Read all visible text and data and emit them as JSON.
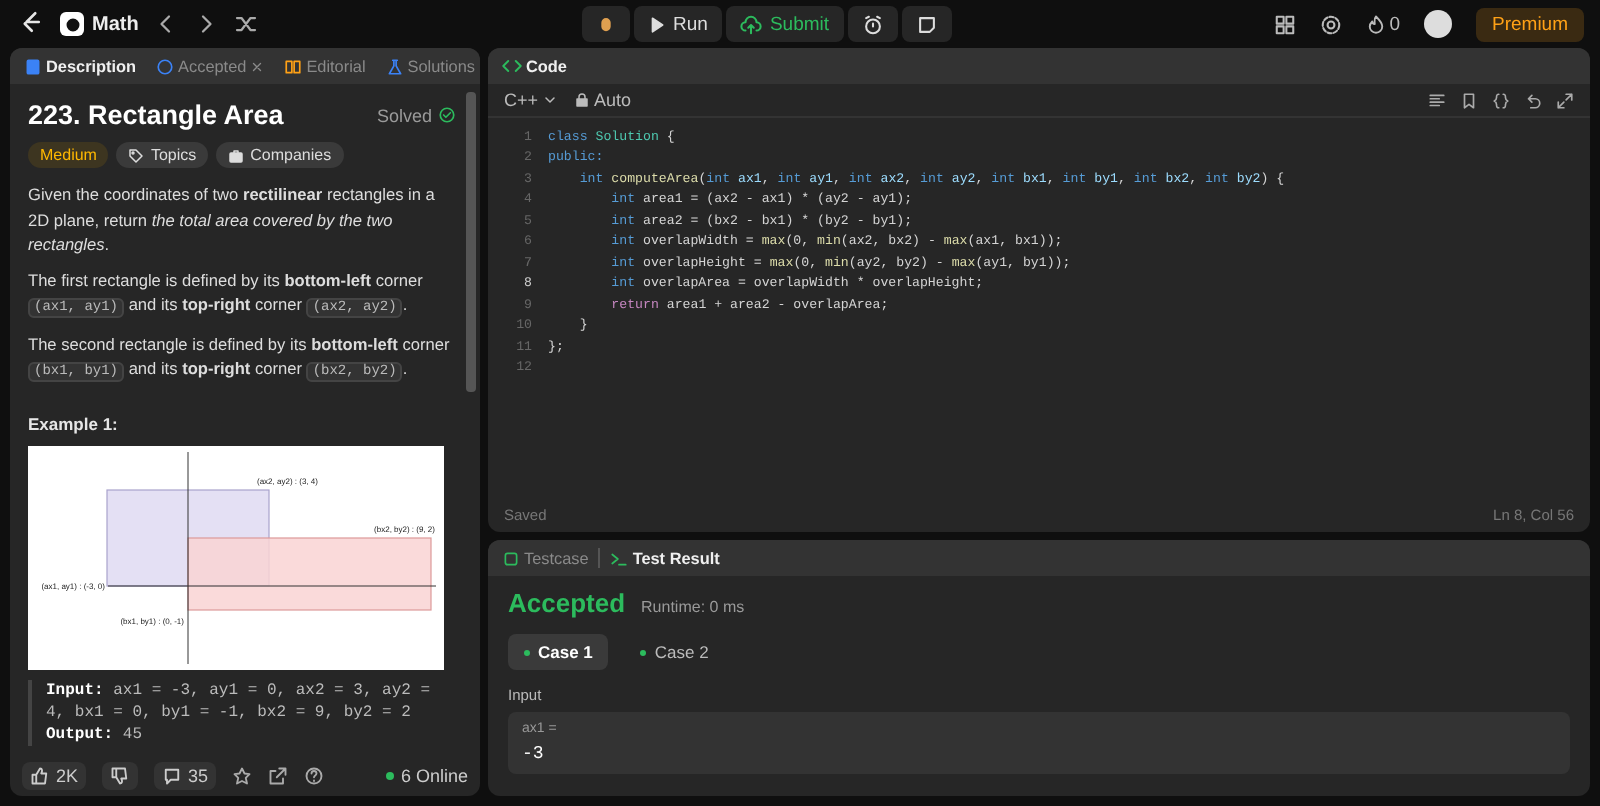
{
  "topbar": {
    "problem_list": "Math",
    "run": "Run",
    "submit": "Submit",
    "streak": "0",
    "premium": "Premium"
  },
  "description_panel": {
    "tabs": [
      {
        "label": "Description",
        "selected": true,
        "closable": false
      },
      {
        "label": "Accepted",
        "selected": false,
        "closable": true
      },
      {
        "label": "Editorial",
        "selected": false,
        "closable": false
      },
      {
        "label": "Solutions",
        "selected": false,
        "closable": false
      }
    ],
    "title": "223. Rectangle Area",
    "status": "Solved",
    "tags": [
      {
        "kind": "difficulty",
        "label": "Medium"
      },
      {
        "kind": "topics",
        "label": "Topics"
      },
      {
        "kind": "companies",
        "label": "Companies"
      }
    ],
    "paragraphs": [
      [
        {
          "kind": "text",
          "text": "Given the coordinates of two **rectilinear** rectangles in a 2D plane, return *the total area covered by the two rectangles*."
        }
      ],
      [
        {
          "kind": "text",
          "text": "The first rectangle is defined by its **bottom-left** corner "
        },
        {
          "kind": "code",
          "text": "(ax1, ay1)"
        },
        {
          "kind": "text",
          "text": " and its **top-right** corner "
        },
        {
          "kind": "code",
          "text": "(ax2, ay2)"
        },
        {
          "kind": "text",
          "text": "."
        }
      ],
      [
        {
          "kind": "text",
          "text": "The second rectangle is defined by its **bottom-left** corner "
        },
        {
          "kind": "code",
          "text": "(bx1, by1)"
        },
        {
          "kind": "text",
          "text": " and its **top-right** corner "
        },
        {
          "kind": "code",
          "text": "(bx2, by2)"
        },
        {
          "kind": "text",
          "text": "."
        }
      ]
    ],
    "example_title": "Example 1:",
    "figure_labels": [
      "(ax2, ay2) : (3, 4)",
      "(bx2, by2) : (9, 2)",
      "(ax1, ay1) : (-3, 0)",
      "(bx1, by1) : (0, -1)"
    ],
    "example_lines": [
      {
        "label": "Input:",
        "text": "ax1 = -3, ay1 = 0, ax2 = 3, ay2 = 4, bx1 = 0, by1 = -1, bx2 = 9, by2 = 2"
      },
      {
        "label": "Output:",
        "text": "45"
      }
    ],
    "likes": "2K",
    "comments": "35",
    "online": "6 Online"
  },
  "code_panel": {
    "title": "Code",
    "language": "C++",
    "mode": "Auto",
    "lines": [
      {
        "number": "1",
        "current": false,
        "tokens": [
          {
            "kind": "kw",
            "text": "class"
          },
          {
            "kind": "cls",
            "text": " Solution"
          },
          {
            "kind": "plain",
            "text": " {"
          }
        ]
      },
      {
        "number": "2",
        "current": false,
        "tokens": [
          {
            "kind": "kw",
            "text": "public:"
          }
        ]
      },
      {
        "number": "3",
        "current": false,
        "tokens": [
          {
            "kind": "kw",
            "text": "    int"
          },
          {
            "kind": "fn",
            "text": " computeArea"
          },
          {
            "kind": "plain",
            "text": "("
          },
          {
            "kind": "kw",
            "text": "int"
          },
          {
            "kind": "id",
            "text": " ax1"
          },
          {
            "kind": "plain",
            "text": ", "
          },
          {
            "kind": "kw",
            "text": "int"
          },
          {
            "kind": "id",
            "text": " ay1"
          },
          {
            "kind": "plain",
            "text": ", "
          },
          {
            "kind": "kw",
            "text": "int"
          },
          {
            "kind": "id",
            "text": " ax2"
          },
          {
            "kind": "plain",
            "text": ", "
          },
          {
            "kind": "kw",
            "text": "int"
          },
          {
            "kind": "id",
            "text": " ay2"
          },
          {
            "kind": "plain",
            "text": ", "
          },
          {
            "kind": "kw",
            "text": "int"
          },
          {
            "kind": "id",
            "text": " bx1"
          },
          {
            "kind": "plain",
            "text": ", "
          },
          {
            "kind": "kw",
            "text": "int"
          },
          {
            "kind": "id",
            "text": " by1"
          },
          {
            "kind": "plain",
            "text": ", "
          },
          {
            "kind": "kw",
            "text": "int"
          },
          {
            "kind": "id",
            "text": " bx2"
          },
          {
            "kind": "plain",
            "text": ", "
          },
          {
            "kind": "kw",
            "text": "int"
          },
          {
            "kind": "id",
            "text": " by2"
          },
          {
            "kind": "plain",
            "text": ") {"
          }
        ]
      },
      {
        "number": "4",
        "current": false,
        "tokens": [
          {
            "kind": "kw",
            "text": "        int"
          },
          {
            "kind": "plain",
            "text": " area1 = (ax2 - ax1) * (ay2 - ay1);"
          }
        ]
      },
      {
        "number": "5",
        "current": false,
        "tokens": [
          {
            "kind": "kw",
            "text": "        int"
          },
          {
            "kind": "plain",
            "text": " area2 = (bx2 - bx1) * (by2 - by1);"
          }
        ]
      },
      {
        "number": "6",
        "current": false,
        "tokens": [
          {
            "kind": "kw",
            "text": "        int"
          },
          {
            "kind": "plain",
            "text": " overlapWidth = "
          },
          {
            "kind": "fn",
            "text": "max"
          },
          {
            "kind": "plain",
            "text": "(0, "
          },
          {
            "kind": "fn",
            "text": "min"
          },
          {
            "kind": "plain",
            "text": "(ax2, bx2) - "
          },
          {
            "kind": "fn",
            "text": "max"
          },
          {
            "kind": "plain",
            "text": "(ax1, bx1));"
          }
        ]
      },
      {
        "number": "7",
        "current": false,
        "tokens": [
          {
            "kind": "kw",
            "text": "        int"
          },
          {
            "kind": "plain",
            "text": " overlapHeight = "
          },
          {
            "kind": "fn",
            "text": "max"
          },
          {
            "kind": "plain",
            "text": "(0, "
          },
          {
            "kind": "fn",
            "text": "min"
          },
          {
            "kind": "plain",
            "text": "(ay2, by2) - "
          },
          {
            "kind": "fn",
            "text": "max"
          },
          {
            "kind": "plain",
            "text": "(ay1, by1));"
          }
        ]
      },
      {
        "number": "8",
        "current": true,
        "tokens": [
          {
            "kind": "kw",
            "text": "        int"
          },
          {
            "kind": "plain",
            "text": " overlapArea = overlapWidth * overlapHeight;"
          }
        ]
      },
      {
        "number": "9",
        "current": false,
        "tokens": [
          {
            "kind": "ret",
            "text": "        return"
          },
          {
            "kind": "plain",
            "text": " area1 + area2 - overlapArea;"
          }
        ]
      },
      {
        "number": "10",
        "current": false,
        "tokens": [
          {
            "kind": "plain",
            "text": "    }"
          }
        ]
      },
      {
        "number": "11",
        "current": false,
        "tokens": [
          {
            "kind": "plain",
            "text": "};"
          }
        ]
      },
      {
        "number": "12",
        "current": false
      }
    ],
    "saved": "Saved",
    "cursor": "Ln 8, Col 56"
  },
  "result_panel": {
    "tabs": [
      {
        "label": "Testcase",
        "selected": false
      },
      {
        "label": "Test Result",
        "selected": true
      }
    ],
    "verdict": "Accepted",
    "runtime": "Runtime: 0 ms",
    "cases": [
      {
        "label": "Case 1",
        "selected": true,
        "passed": true
      },
      {
        "label": "Case 2",
        "selected": false,
        "passed": true
      }
    ],
    "input_label": "Input",
    "inputs": [
      {
        "name": "ax1 =",
        "value": "-3"
      }
    ]
  }
}
